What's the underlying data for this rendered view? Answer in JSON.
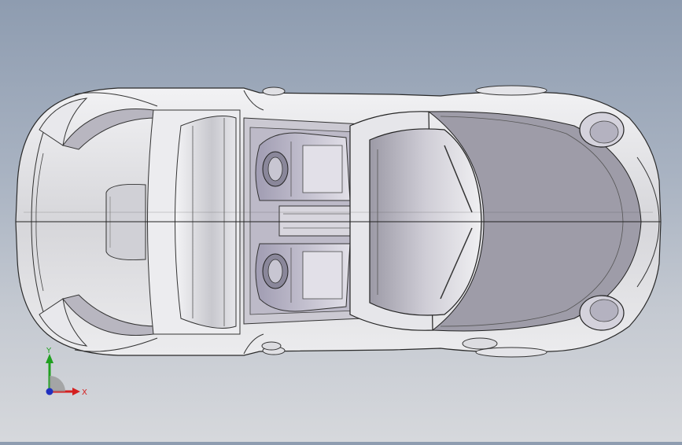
{
  "viewport": {
    "model": "car-top-view",
    "background_top": "#8e9cb0",
    "background_bottom": "#d6d8dc",
    "body_color": "#d9d9dd",
    "edge_color": "#2a2a2a",
    "interior_color": "#b8b4c4"
  },
  "triad": {
    "x_label": "X",
    "y_label": "Y",
    "x_color": "#d42020",
    "y_color": "#20a020",
    "z_color": "#2030c0"
  }
}
